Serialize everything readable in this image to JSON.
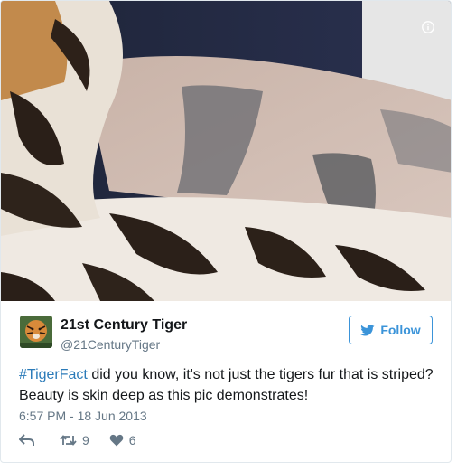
{
  "tweet": {
    "author_name": "21st Century Tiger",
    "author_handle": "@21CenturyTiger",
    "follow_label": "Follow",
    "hashtag": "#TigerFact",
    "text_rest": " did you know, it's not just the tigers fur that is striped? Beauty is skin deep as this pic demonstrates!",
    "timestamp": "6:57 PM - 18 Jun 2013",
    "retweets": "9",
    "likes": "6"
  },
  "icons": {
    "info": "info-icon",
    "bird": "twitter-bird-icon",
    "reply": "reply-icon",
    "retweet": "retweet-icon",
    "like": "heart-icon"
  },
  "colors": {
    "accent": "#3b94d9",
    "link": "#2b7bb9",
    "muted": "#657786",
    "border": "#e1e8ed"
  }
}
